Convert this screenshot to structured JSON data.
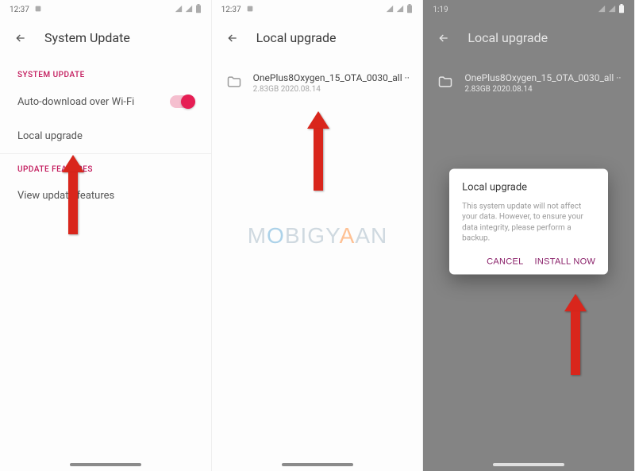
{
  "panel1": {
    "time": "12:37",
    "header_title": "System Update",
    "section1_label": "SYSTEM UPDATE",
    "row_autodownload": "Auto-download over Wi-Fi",
    "row_local_upgrade": "Local upgrade",
    "section2_label": "UPDATE FEATURES",
    "row_view_features": "View update features"
  },
  "panel2": {
    "time": "12:37",
    "header_title": "Local upgrade",
    "file_name": "OnePlus8Oxygen_15_OTA_0030_all ··",
    "file_meta": "2.83GB  2020.08.14"
  },
  "panel3": {
    "time": "1:19",
    "header_title": "Local upgrade",
    "file_name": "OnePlus8Oxygen_15_OTA_0030_all ··",
    "file_meta": "2.83GB  2020.08.14",
    "dialog": {
      "title": "Local upgrade",
      "body": "This system update will not affect your data.\nHowever, to ensure your data integrity, please perform a backup.",
      "cancel": "CANCEL",
      "install": "INSTALL NOW"
    }
  },
  "watermark": "MOBIGYAAN"
}
